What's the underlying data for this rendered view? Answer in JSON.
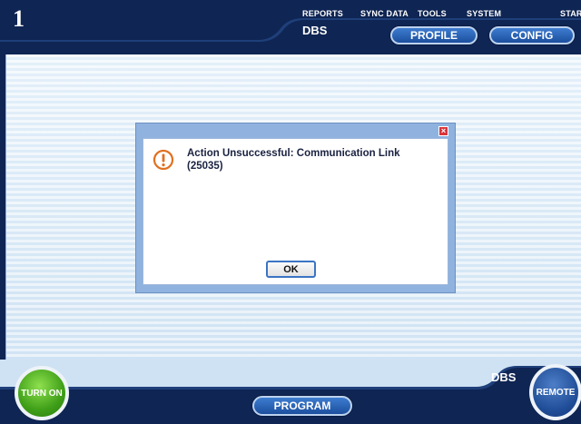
{
  "header": {
    "screen_number": "1",
    "menu": [
      "REPORTS",
      "SYNC DATA",
      "TOOLS",
      "SYSTEM",
      "STAR"
    ],
    "mode_label": "DBS",
    "profile_label": "PROFILE",
    "config_label": "CONFIG"
  },
  "dialog": {
    "message_line1": "Action Unsuccessful:  Communication Link",
    "message_line2": "(25035)",
    "ok_label": "OK",
    "close_glyph": "×",
    "icon": "warning-circle-icon"
  },
  "footer": {
    "turn_on_label": "TURN ON",
    "program_label": "PROGRAM",
    "mode_label": "DBS",
    "remote_label": "REMOTE"
  },
  "colors": {
    "chrome": "#0f2553",
    "accent": "#2a5fb0",
    "alert": "#e07020",
    "turn_on": "#4caf20",
    "dialog_frame": "#8fb2de"
  }
}
